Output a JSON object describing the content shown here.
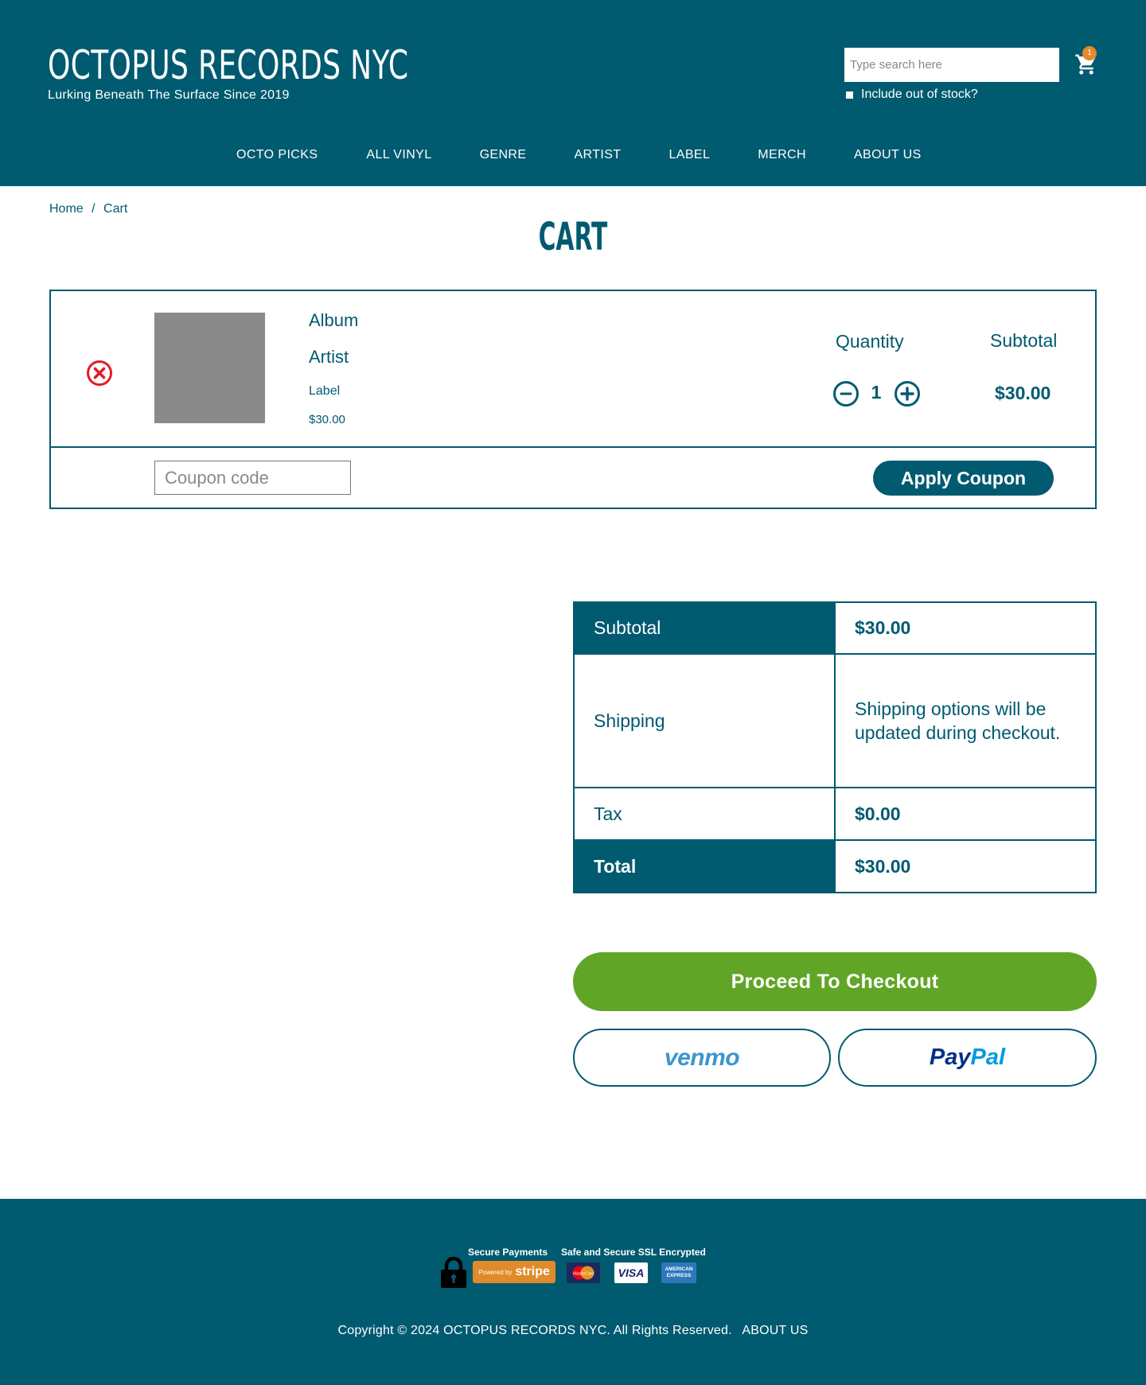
{
  "header": {
    "logo": "OCTOPUS RECORDS NYC",
    "tagline": "Lurking Beneath The Surface Since 2019",
    "search_placeholder": "Type search here",
    "stock_label": "Include out of stock?",
    "cart_count": "1"
  },
  "nav": {
    "items": [
      "OCTO PICKS",
      "ALL VINYL",
      "GENRE",
      "ARTIST",
      "LABEL",
      "MERCH",
      "ABOUT US"
    ]
  },
  "breadcrumb": {
    "home": "Home",
    "separator": "/",
    "current": "Cart"
  },
  "page_title": "CART",
  "cart": {
    "item": {
      "album": "Album",
      "artist": "Artist",
      "label": "Label",
      "price": "$30.00",
      "quantity": "1",
      "subtotal": "$30.00"
    },
    "quantity_header": "Quantity",
    "subtotal_header": "Subtotal",
    "qty_minus": "-",
    "qty_plus": "+",
    "coupon_placeholder": "Coupon code",
    "apply_label": "Apply Coupon"
  },
  "totals": {
    "subtotal_label": "Subtotal",
    "subtotal_value": "$30.00",
    "shipping_label": "Shipping",
    "shipping_value": "Shipping options will be updated during checkout.",
    "tax_label": "Tax",
    "tax_value": "$0.00",
    "total_label": "Total",
    "total_value": "$30.00"
  },
  "checkout": {
    "proceed_label": "Proceed To Checkout",
    "venmo_label": "venmo",
    "paypal_pay": "Pay",
    "paypal_pal": "Pal"
  },
  "footer": {
    "secure_title": "Secure Payments",
    "ssl_title": "Safe and Secure SSL Encrypted",
    "stripe_powered": "Powered by",
    "stripe_name": "stripe",
    "mastercard": "MasterCard",
    "visa": "VISA",
    "amex_1": "AMERICAN",
    "amex_2": "EXPRESS",
    "copyright": "Copyright © 2024 OCTOPUS RECORDS NYC. All Rights Reserved.",
    "about_link": "ABOUT US"
  },
  "colors": {
    "brand": "#005a70",
    "checkout": "#61a526",
    "badge": "#e08a2a",
    "remove": "#e31b23"
  }
}
